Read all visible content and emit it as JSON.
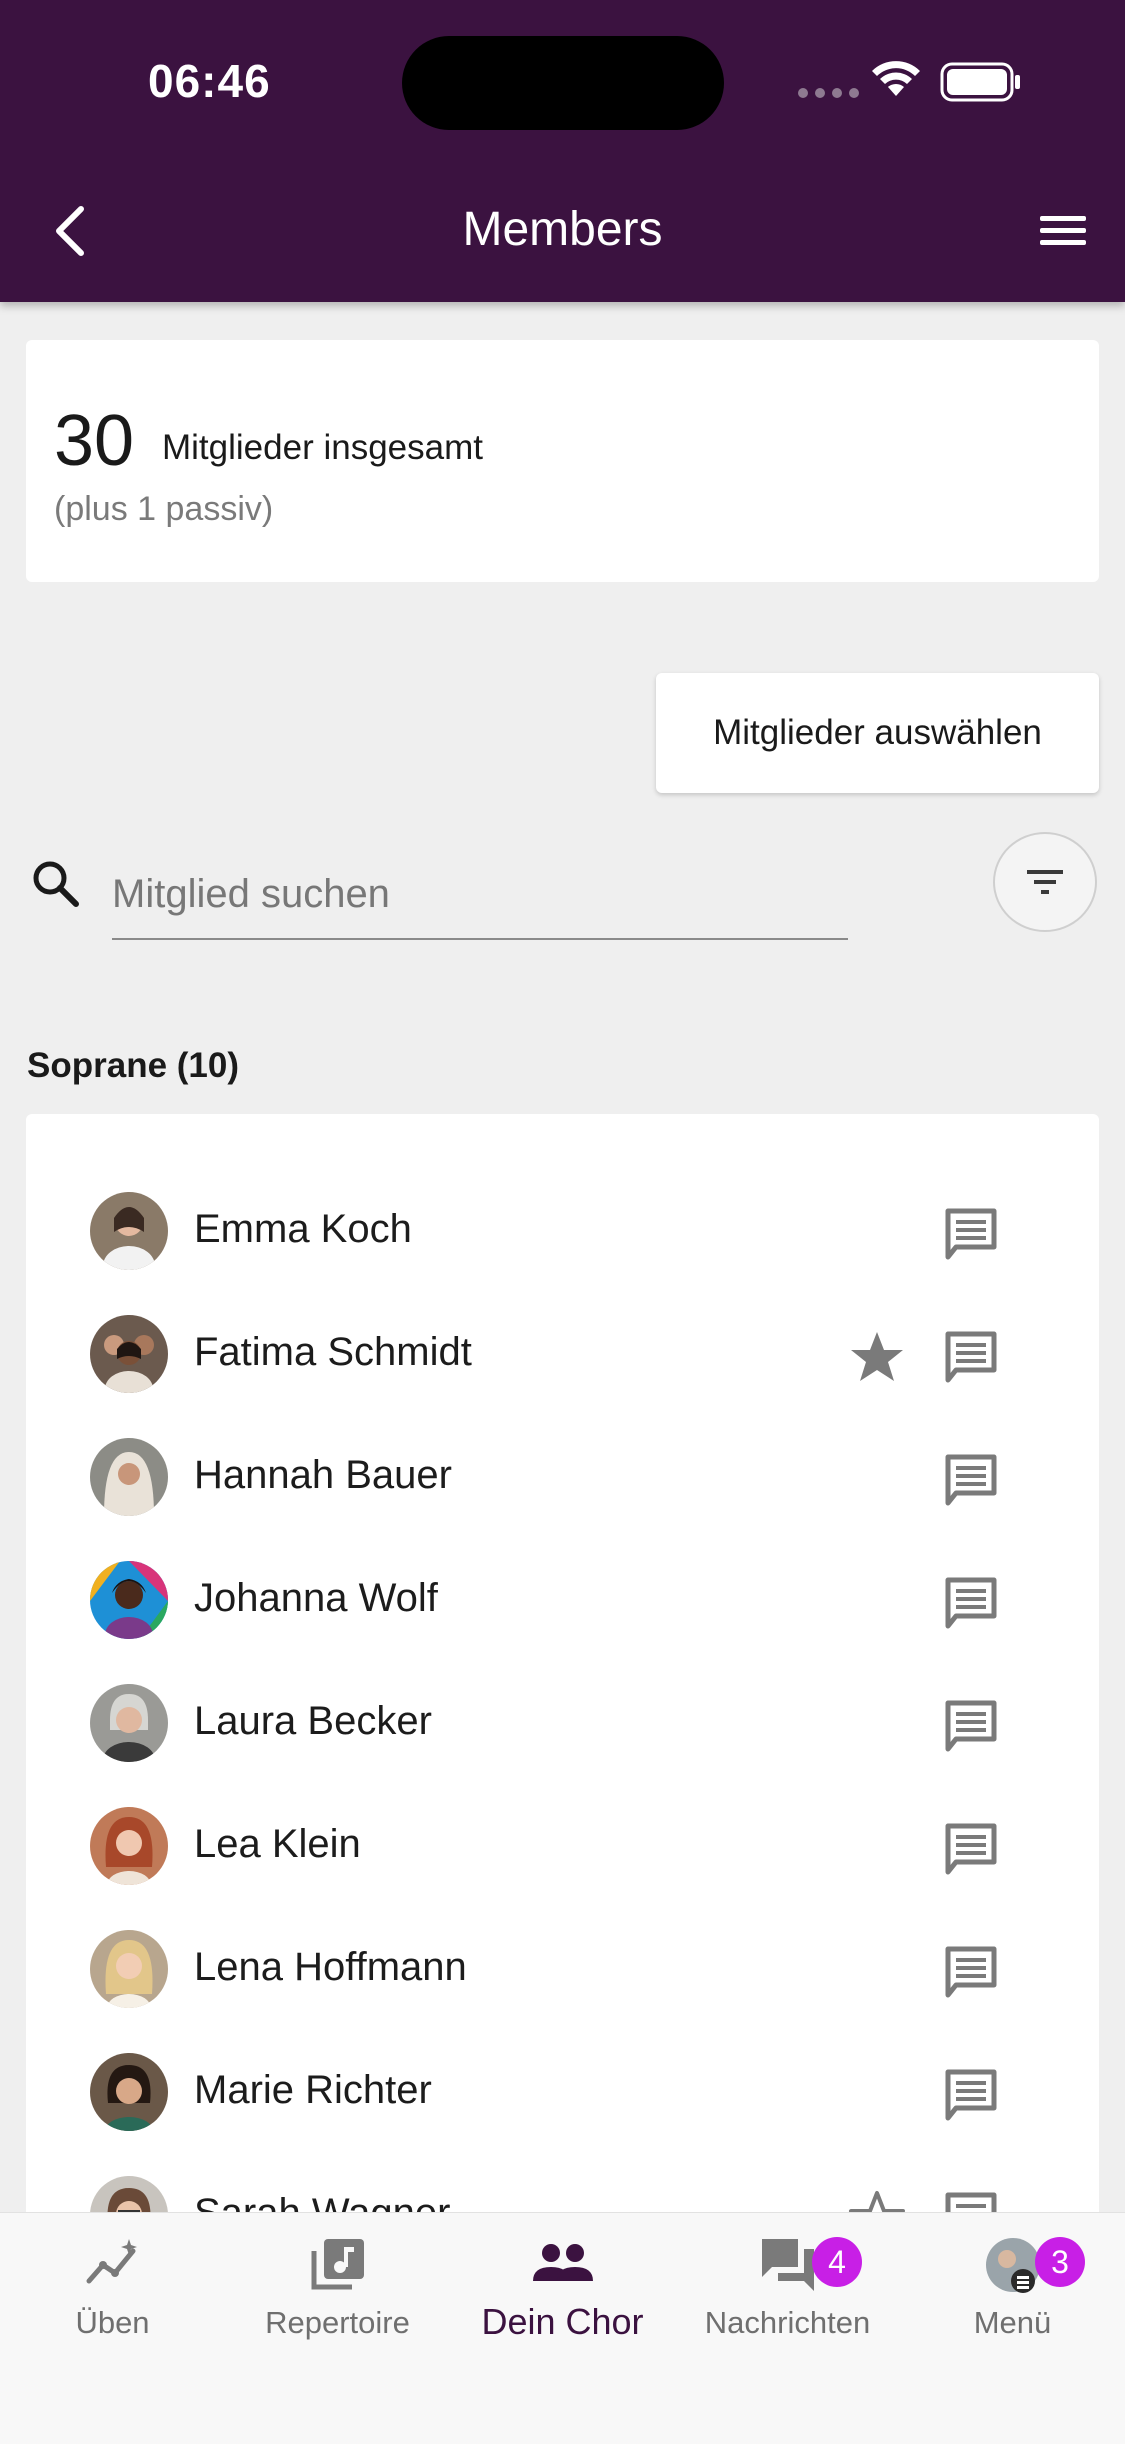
{
  "status_bar": {
    "time": "06:46"
  },
  "header": {
    "title": "Members"
  },
  "summary": {
    "count": "30",
    "count_label": "Mitglieder insgesamt",
    "passive": "(plus 1 passiv)"
  },
  "select_button": {
    "label": "Mitglieder auswählen"
  },
  "search": {
    "placeholder": "Mitglied suchen"
  },
  "section": {
    "title": "Soprane (10)"
  },
  "members": [
    {
      "name": "Emma Koch",
      "starred": false
    },
    {
      "name": "Fatima Schmidt",
      "starred": true
    },
    {
      "name": "Hannah Bauer",
      "starred": false
    },
    {
      "name": "Johanna Wolf",
      "starred": false
    },
    {
      "name": "Laura Becker",
      "starred": false
    },
    {
      "name": "Lea Klein",
      "starred": false
    },
    {
      "name": "Lena Hoffmann",
      "starred": false
    },
    {
      "name": "Marie Richter",
      "starred": false
    },
    {
      "name": "Sarah Wagner",
      "starred": true
    }
  ],
  "tabs": [
    {
      "label": "Üben",
      "icon": "practice-icon"
    },
    {
      "label": "Repertoire",
      "icon": "repertoire-icon"
    },
    {
      "label": "Dein Chor",
      "icon": "group-icon",
      "active": true
    },
    {
      "label": "Nachrichten",
      "icon": "messages-icon",
      "badge": "4"
    },
    {
      "label": "Menü",
      "icon": "profile-avatar",
      "badge": "3"
    }
  ],
  "colors": {
    "primary": "#3b1240",
    "badge": "#c81fe6",
    "icon_gray": "#7a7a7a"
  }
}
